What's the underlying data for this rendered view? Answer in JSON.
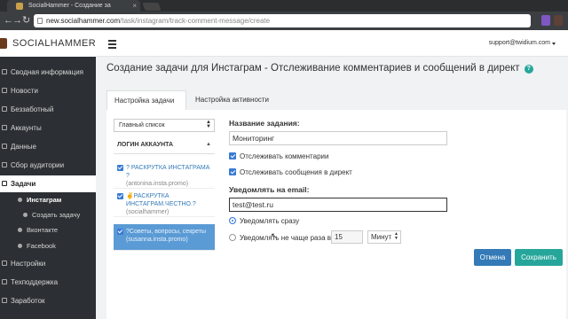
{
  "browser": {
    "tab_title": "SocialHammer - Создание за",
    "tab_close": "×",
    "url_host": "new.socialhammer.com",
    "url_path": "/task/instagram/track-comment-message/create",
    "nav_back": "←",
    "nav_forward": "→",
    "nav_reload": "↻"
  },
  "header": {
    "logo": "SOCIALHAMMER",
    "user_email": "support@twidium.com"
  },
  "sidebar": {
    "items": [
      {
        "label": "Сводная информация"
      },
      {
        "label": "Новости"
      },
      {
        "label": "Беззаботный"
      },
      {
        "label": "Аккаунты"
      },
      {
        "label": "Данные"
      },
      {
        "label": "Сбор аудитории"
      },
      {
        "label": "Задачи"
      },
      {
        "label": "Инстаграм"
      },
      {
        "label": "Создать задачу"
      },
      {
        "label": "Вконтакте"
      },
      {
        "label": "Facebook"
      },
      {
        "label": "Настройки"
      },
      {
        "label": "Техподдержка"
      },
      {
        "label": "Заработок"
      }
    ]
  },
  "main": {
    "title": "Создание задачи для Инстаграм - Отслеживание комментариев и сообщений в директ",
    "help": "?",
    "tabs": [
      {
        "label": "Настройка задачи"
      },
      {
        "label": "Настройка активности"
      }
    ],
    "accounts": {
      "list_select": "Главный список",
      "header": "ЛОГИН АККАУНТА",
      "sort_icon": "▲",
      "items": [
        {
          "name": "? РАСКРУТКА ИНСТАГРАМА ?",
          "login": "(antonina.insta.promo)"
        },
        {
          "name": "✌РАСКРУТКА ИНСТАГРАМ.ЧЕСТНО.?",
          "login": "(socialhammer)"
        },
        {
          "name": "?Советы, вопросы, секреты",
          "login": "(susanna.insta.promo)"
        }
      ]
    },
    "form": {
      "task_name_label": "Название задания:",
      "task_name_value": "Мониторинг",
      "track_comments": "Отслеживать комментарии",
      "track_messages": "Отслеживать сообщения в директ",
      "notify_label": "Уведомлять на email:",
      "notify_value": "test@test.ru",
      "notify_now": "Уведомлять сразу",
      "notify_interval": "Уведомлять не чаще раза в:",
      "interval_value": "15",
      "interval_unit": "Минут",
      "cancel": "Отмена",
      "save": "Сохранить"
    }
  },
  "colors": {
    "sidebar_bg": "#2c3034",
    "accent_teal": "#26a69a",
    "accent_blue": "#337ab7",
    "selected_row": "#5b9bd5"
  }
}
